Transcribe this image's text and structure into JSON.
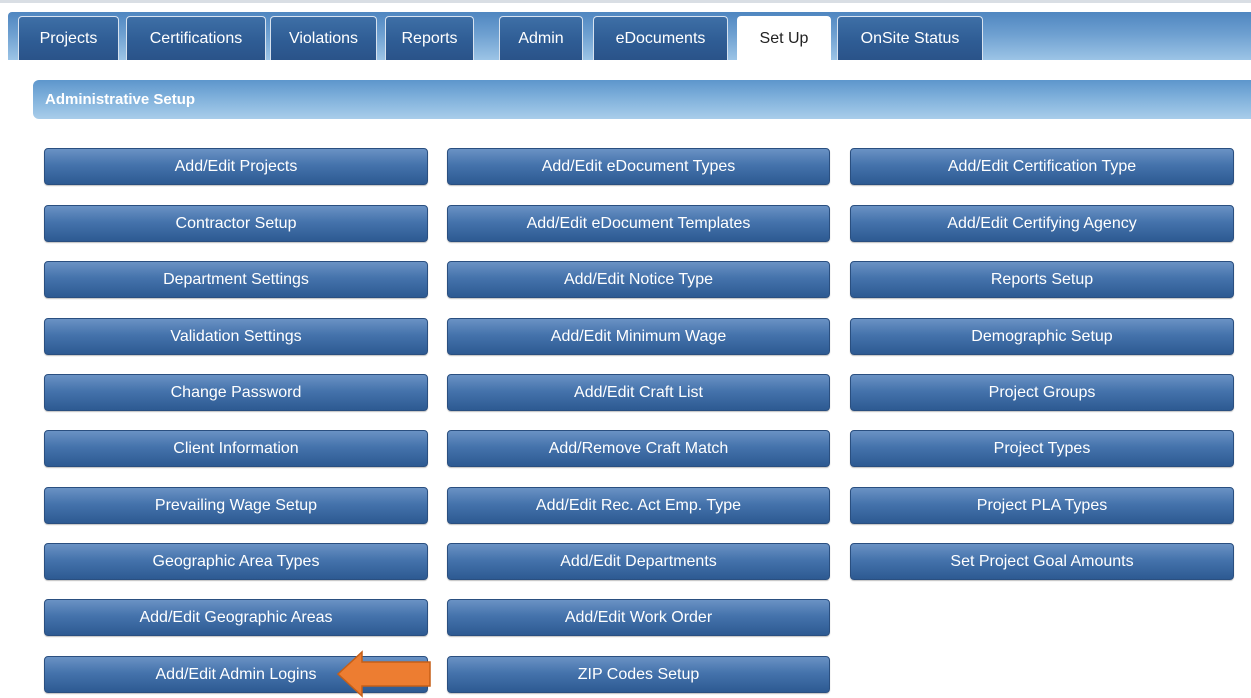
{
  "tabs": [
    {
      "label": "Projects",
      "active": false
    },
    {
      "label": "Certifications",
      "active": false
    },
    {
      "label": "Violations",
      "active": false
    },
    {
      "label": "Reports",
      "active": false
    },
    {
      "label": "Admin",
      "active": false
    },
    {
      "label": "eDocuments",
      "active": false
    },
    {
      "label": "Set Up",
      "active": true
    },
    {
      "label": "OnSite Status",
      "active": false
    }
  ],
  "panel": {
    "title": "Administrative Setup"
  },
  "buttons": {
    "col1": [
      "Add/Edit Projects",
      "Contractor Setup",
      "Department Settings",
      "Validation Settings",
      "Change Password",
      "Client Information",
      "Prevailing Wage Setup",
      "Geographic Area Types",
      "Add/Edit Geographic Areas",
      "Add/Edit Admin Logins"
    ],
    "col2": [
      "Add/Edit eDocument Types",
      "Add/Edit eDocument Templates",
      "Add/Edit Notice Type",
      "Add/Edit Minimum Wage",
      "Add/Edit Craft List",
      "Add/Remove Craft Match",
      "Add/Edit Rec. Act Emp. Type",
      "Add/Edit Departments",
      "Add/Edit Work Order",
      "ZIP Codes Setup"
    ],
    "col3": [
      "Add/Edit Certification Type",
      "Add/Edit Certifying Agency",
      "Reports Setup",
      "Demographic Setup",
      "Project Groups",
      "Project Types",
      "Project PLA Types",
      "Set Project Goal Amounts"
    ]
  },
  "colors": {
    "button_blue": "#2d5a92",
    "header_blue": "#5d96cc",
    "arrow_orange": "#ed7d31"
  },
  "annotation": {
    "icon": "arrow-left-icon"
  }
}
